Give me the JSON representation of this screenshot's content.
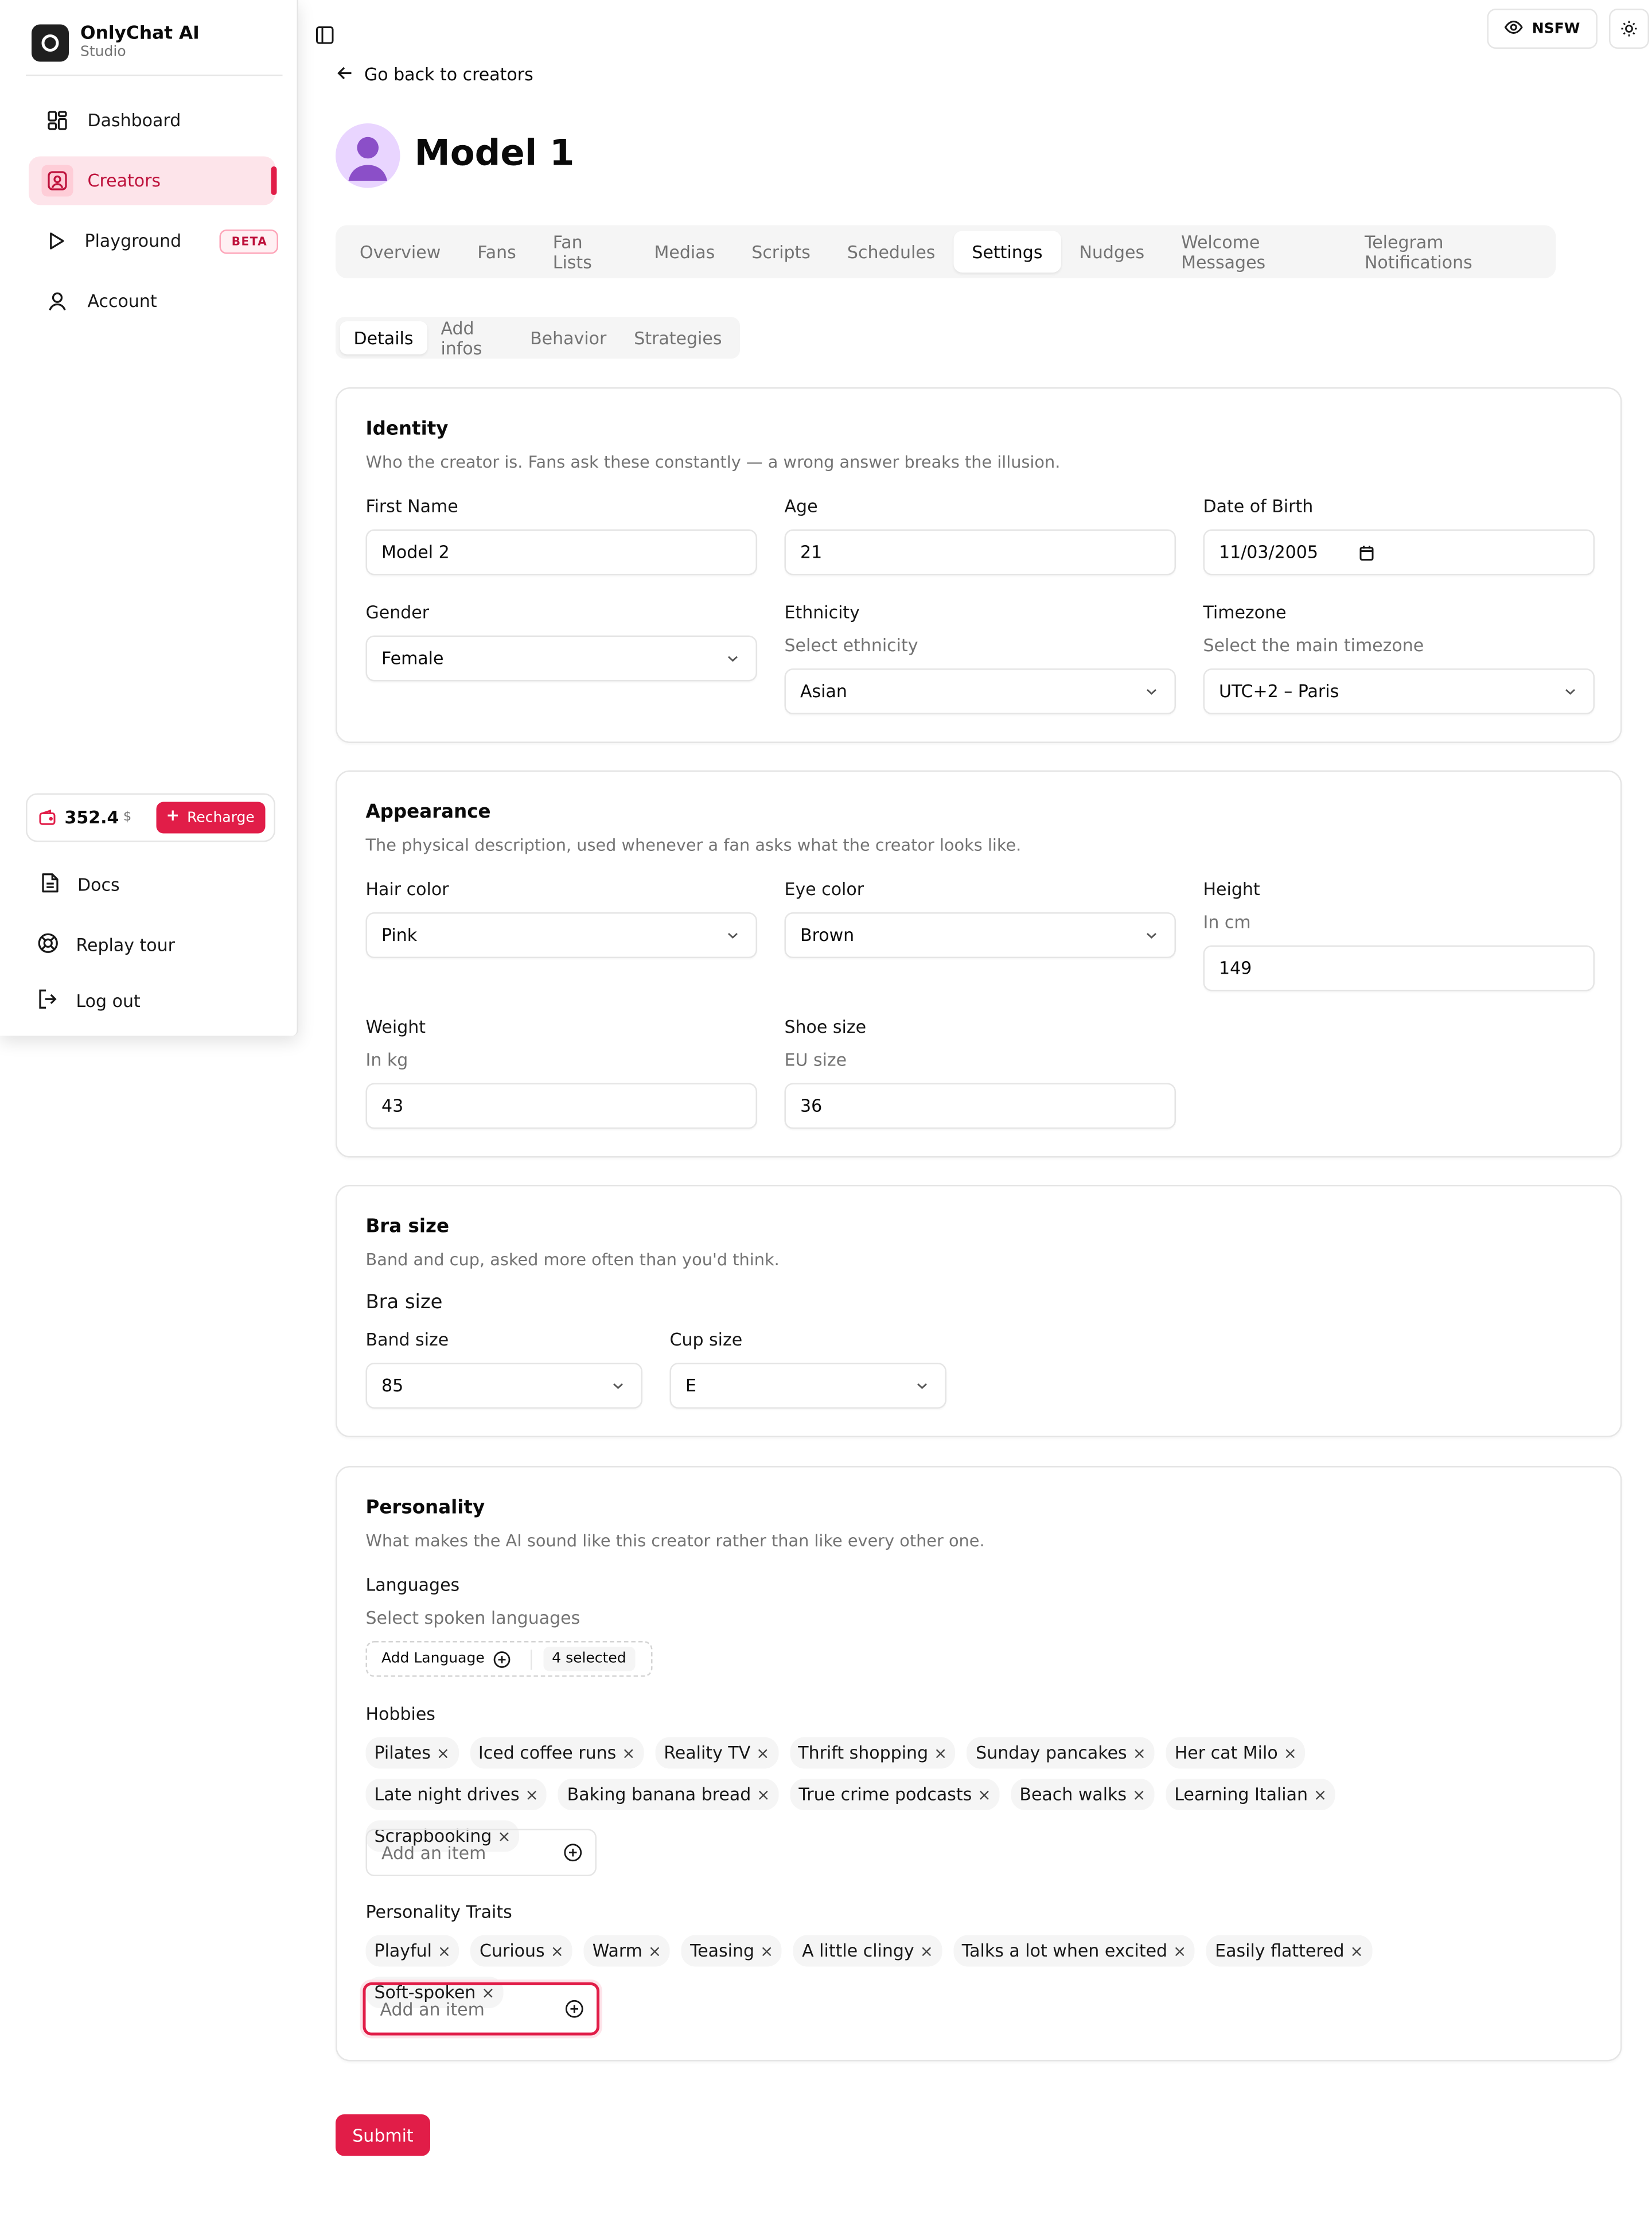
{
  "app": {
    "name": "OnlyChat AI",
    "subtitle": "Studio",
    "logo_text": "OnlyChatAI"
  },
  "sidebar": {
    "items": [
      {
        "label": "Dashboard",
        "icon": "grid-icon"
      },
      {
        "label": "Creators",
        "icon": "user-square-icon",
        "active": true
      },
      {
        "label": "Playground",
        "icon": "play-icon",
        "badge": "BETA"
      },
      {
        "label": "Account",
        "icon": "user-icon"
      }
    ],
    "wallet": {
      "amount": "352.4",
      "currency": "$",
      "recharge_label": "Recharge"
    },
    "footer": [
      {
        "label": "Docs",
        "icon": "document-icon"
      },
      {
        "label": "Replay tour",
        "icon": "lifebuoy-icon"
      },
      {
        "label": "Log out",
        "icon": "logout-icon"
      }
    ]
  },
  "topbar": {
    "nsfw_label": "NSFW"
  },
  "header": {
    "back_label": "Go back to creators",
    "title": "Model 1"
  },
  "tabs": [
    "Overview",
    "Fans",
    "Fan Lists",
    "Medias",
    "Scripts",
    "Schedules",
    "Settings",
    "Nudges",
    "Welcome Messages",
    "Telegram Notifications"
  ],
  "active_tab": "Settings",
  "subtabs": [
    "Details",
    "Add infos",
    "Behavior",
    "Strategies"
  ],
  "active_subtab": "Details",
  "identity": {
    "title": "Identity",
    "desc": "Who the creator is. Fans ask these constantly — a wrong answer breaks the illusion.",
    "first_name": {
      "label": "First Name",
      "value": "Model 2"
    },
    "age": {
      "label": "Age",
      "value": "21"
    },
    "dob": {
      "label": "Date of Birth",
      "value": "11/03/2005"
    },
    "gender": {
      "label": "Gender",
      "value": "Female"
    },
    "ethnicity": {
      "label": "Ethnicity",
      "hint": "Select ethnicity",
      "value": "Asian"
    },
    "timezone": {
      "label": "Timezone",
      "hint": "Select the main timezone",
      "value": "UTC+2 – Paris"
    }
  },
  "appearance": {
    "title": "Appearance",
    "desc": "The physical description, used whenever a fan asks what the creator looks like.",
    "hair": {
      "label": "Hair color",
      "value": "Pink"
    },
    "eye": {
      "label": "Eye color",
      "value": "Brown"
    },
    "height": {
      "label": "Height",
      "hint": "In cm",
      "value": "149"
    },
    "weight": {
      "label": "Weight",
      "hint": "In kg",
      "value": "43"
    },
    "shoe": {
      "label": "Shoe size",
      "hint": "EU size",
      "value": "36"
    }
  },
  "bra": {
    "title": "Bra size",
    "desc": "Band and cup, asked more often than you'd think.",
    "subtitle": "Bra size",
    "band": {
      "label": "Band size",
      "value": "85"
    },
    "cup": {
      "label": "Cup size",
      "value": "E"
    }
  },
  "personality": {
    "title": "Personality",
    "desc": "What makes the AI sound like this creator rather than like every other one.",
    "languages": {
      "label": "Languages",
      "hint": "Select spoken languages",
      "add_label": "Add Language",
      "selected": "4 selected"
    },
    "hobbies": {
      "label": "Hobbies",
      "items": [
        "Pilates",
        "Iced coffee runs",
        "Reality TV",
        "Thrift shopping",
        "Sunday pancakes",
        "Her cat Milo",
        "Late night drives",
        "Baking banana bread",
        "True crime podcasts",
        "Beach walks",
        "Learning Italian",
        "Scrapbooking"
      ],
      "placeholder": "Add an item"
    },
    "traits": {
      "label": "Personality Traits",
      "items": [
        "Playful",
        "Curious",
        "Warm",
        "Teasing",
        "A little clingy",
        "Talks a lot when excited",
        "Easily flattered",
        "Soft-spoken"
      ],
      "placeholder": "Add an item"
    }
  },
  "submit_label": "Submit",
  "colors": {
    "accent": "#e11d48",
    "accent_bg": "#fde4ea",
    "border": "#e5e5e5",
    "muted": "#737373"
  }
}
